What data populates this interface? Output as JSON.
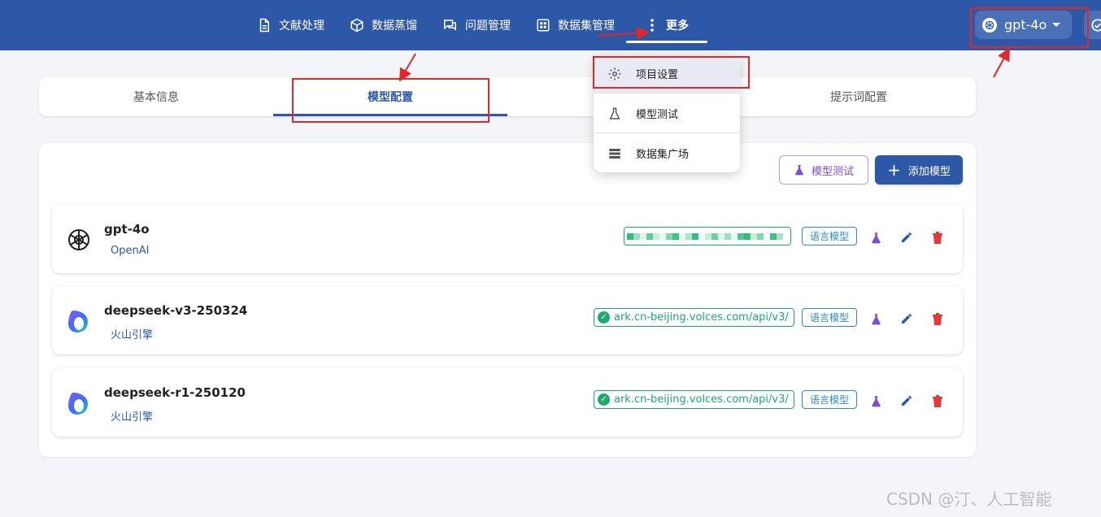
{
  "nav": {
    "items": [
      {
        "label": "文献处理",
        "icon": "document-icon"
      },
      {
        "label": "数据蒸馏",
        "icon": "cube-icon"
      },
      {
        "label": "问题管理",
        "icon": "chat-icon"
      },
      {
        "label": "数据集管理",
        "icon": "grid-icon"
      },
      {
        "label": "更多",
        "icon": "more-vertical-icon"
      }
    ],
    "active_model": "gpt-4o"
  },
  "tabs": [
    {
      "label": "基本信息"
    },
    {
      "label": "模型配置",
      "active": true
    },
    {
      "label": "提示词配置"
    }
  ],
  "dropdown": {
    "items": [
      {
        "label": "项目设置",
        "icon": "gear-icon"
      },
      {
        "label": "模型测试",
        "icon": "flask-icon"
      },
      {
        "label": "数据集广场",
        "icon": "list-icon"
      }
    ]
  },
  "toolbar": {
    "test_label": "模型测试",
    "add_label": "添加模型"
  },
  "models": [
    {
      "name": "gpt-4o",
      "provider": "OpenAI",
      "endpoint": "",
      "type": "语言模型"
    },
    {
      "name": "deepseek-v3-250324",
      "provider": "火山引擎",
      "endpoint": "ark.cn-beijing.volces.com/api/v3/",
      "type": "语言模型"
    },
    {
      "name": "deepseek-r1-250120",
      "provider": "火山引擎",
      "endpoint": "ark.cn-beijing.volces.com/api/v3/",
      "type": "语言模型"
    }
  ],
  "watermark": "CSDN @汀、人工智能",
  "colors": {
    "primary": "#2d58a8",
    "success": "#1aab6d",
    "purple": "#7a4fd6",
    "danger": "#e53935",
    "annotation": "#e0282b"
  }
}
